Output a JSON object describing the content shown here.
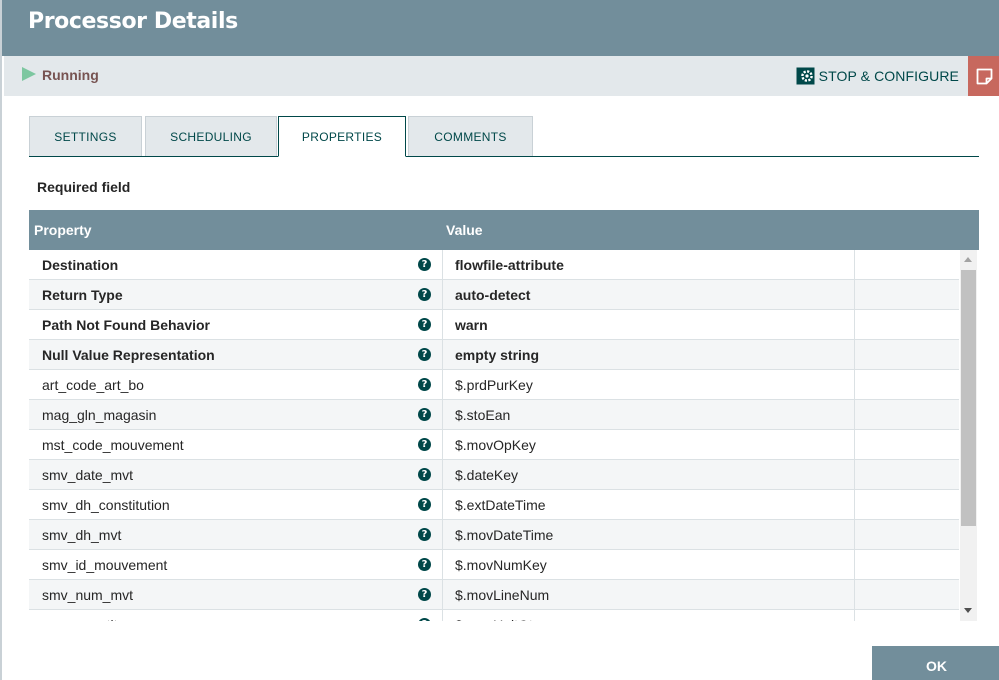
{
  "header": {
    "title": "Processor Details"
  },
  "status": {
    "label": "Running",
    "stop_configure_label": "STOP & CONFIGURE"
  },
  "tabs": [
    {
      "label": "SETTINGS"
    },
    {
      "label": "SCHEDULING"
    },
    {
      "label": "PROPERTIES",
      "active": true
    },
    {
      "label": "COMMENTS"
    }
  ],
  "required_label": "Required field",
  "table": {
    "headers": {
      "property": "Property",
      "value": "Value"
    },
    "rows": [
      {
        "property": "Destination",
        "value": "flowfile-attribute",
        "required": true
      },
      {
        "property": "Return Type",
        "value": "auto-detect",
        "required": true
      },
      {
        "property": "Path Not Found Behavior",
        "value": "warn",
        "required": true
      },
      {
        "property": "Null Value Representation",
        "value": "empty string",
        "required": true
      },
      {
        "property": "art_code_art_bo",
        "value": "$.prdPurKey",
        "required": false
      },
      {
        "property": "mag_gln_magasin",
        "value": "$.stoEan",
        "required": false
      },
      {
        "property": "mst_code_mouvement",
        "value": "$.movOpKey",
        "required": false
      },
      {
        "property": "smv_date_mvt",
        "value": "$.dateKey",
        "required": false
      },
      {
        "property": "smv_dh_constitution",
        "value": "$.extDateTime",
        "required": false
      },
      {
        "property": "smv_dh_mvt",
        "value": "$.movDateTime",
        "required": false
      },
      {
        "property": "smv_id_mouvement",
        "value": "$.movNumKey",
        "required": false
      },
      {
        "property": "smv_num_mvt",
        "value": "$.movLineNum",
        "required": false
      },
      {
        "property": "smv_quantite",
        "value": "$.movUnitQty",
        "required": false
      }
    ]
  },
  "footer": {
    "ok_label": "OK"
  },
  "icons": {
    "run": "play-icon",
    "stop": "gear-icon",
    "note": "note-icon",
    "help": "help-icon"
  },
  "colors": {
    "header": "#728e9b",
    "status_bar": "#e3e8eb",
    "accent": "#004849",
    "running": "#7dc7a0",
    "note": "#c7685e"
  }
}
